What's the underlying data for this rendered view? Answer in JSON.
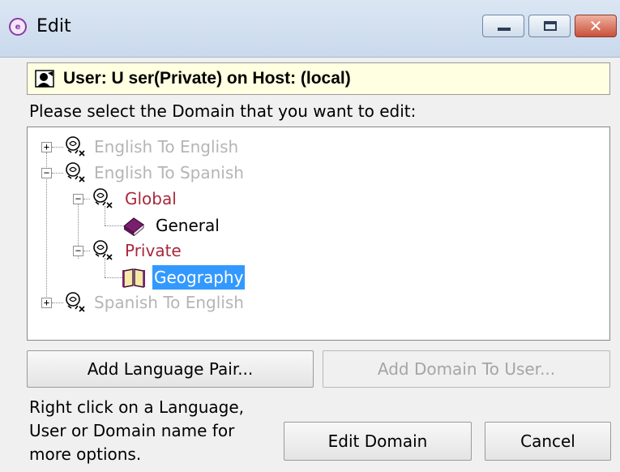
{
  "window": {
    "title": "Edit",
    "app_icon_glyph": "e",
    "controls": {
      "minimize": "minimize-icon",
      "maximize": "maximize-icon",
      "close": "close-icon",
      "close_glyph": "✕"
    },
    "accent": "#3399ff"
  },
  "user_bar": {
    "text": "User: U ser(Private) on Host: (local)",
    "icon": "user-icon"
  },
  "prompt": "Please select the Domain that you want to edit:",
  "tree": {
    "nodes": [
      {
        "label": "English To English",
        "kind": "language-pair",
        "expander": "+",
        "style": "gray"
      },
      {
        "label": "English To Spanish",
        "kind": "language-pair",
        "expander": "−",
        "style": "gray"
      },
      {
        "label": "Global",
        "kind": "user",
        "expander": "−",
        "style": "red"
      },
      {
        "label": "General",
        "kind": "domain",
        "style": "black"
      },
      {
        "label": "Private",
        "kind": "user",
        "expander": "−",
        "style": "red"
      },
      {
        "label": "Geography",
        "kind": "domain",
        "style": "selected"
      },
      {
        "label": "Spanish To English",
        "kind": "language-pair",
        "expander": "+",
        "style": "gray"
      }
    ]
  },
  "buttons": {
    "add_language_pair": "Add Language Pair...",
    "add_domain_to_user": "Add Domain To User...",
    "edit_domain": "Edit Domain",
    "cancel": "Cancel"
  },
  "hint": "Right click on a Language, User or Domain name for more options."
}
